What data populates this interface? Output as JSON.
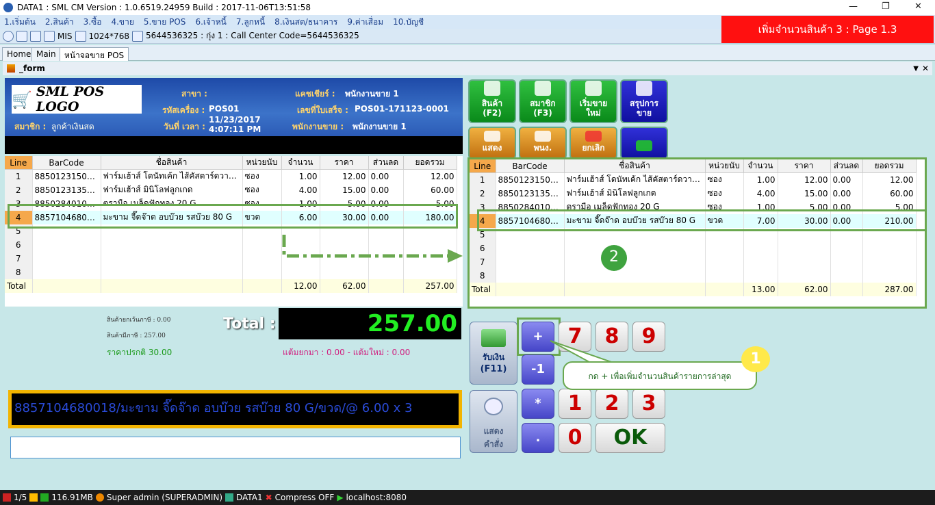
{
  "window": {
    "title": "DATA1 : SML CM Version : 1.0.6519.24959  Build : 2017-11-06T13:51:58"
  },
  "menu": [
    "1.เริ่มต้น",
    "2.สินค้า",
    "3.ซื้อ",
    "4.ขาย",
    "5.ขาย POS",
    "6.เจ้าหนี้",
    "7.ลูกหนี้",
    "8.เงินสด/ธนาคาร",
    "9.ค่าเสื่อม",
    "10.บัญชี"
  ],
  "toolbar": {
    "mis": "MIS",
    "resolution": "1024*768",
    "info": "5644536325 : กุ่ง 1 : Call Center Code=5644536325"
  },
  "banner": "เพิ่มจำนวนสินค้า 3 : Page 1.3",
  "tabs": [
    "Home",
    "Main",
    "หน้าจอขาย POS"
  ],
  "form_title": "_form",
  "header": {
    "logo": "SML POS LOGO",
    "branch_label": "สาขา :",
    "machine_label": "รหัสเครื่อง :",
    "machine_value": "POS01",
    "datetime_label": "วันที่ เวลา :",
    "date_value": "11/23/2017",
    "time_value": "4:07:11 PM",
    "member_label": "สมาชิก :",
    "member_value": "ลูกค้าเงินสด",
    "cashier_label": "แคชเชียร์ :",
    "cashier_value": "พนักงานขาย 1",
    "receipt_label": "เลขที่ใบเสร็จ :",
    "receipt_value": "POS01-171123-0001",
    "sales_label": "พนักงานขาย :",
    "sales_value": "พนักงานขาย 1"
  },
  "columns": [
    "Line",
    "BarCode",
    "ชื่อสินค้า",
    "หน่วยนับ",
    "จำนวน",
    "ราคา",
    "ส่วนลด",
    "ยอดรวม"
  ],
  "left_rows": [
    {
      "line": "1",
      "barcode": "8850123150500",
      "name": "ฟาร์มเฮ้าส์  โดนัทเค้ก ไส้คัสตาร์ดวานิล..",
      "unit": "ซอง",
      "qty": "1.00",
      "price": "12.00",
      "disc": "0.00",
      "total": "12.00"
    },
    {
      "line": "2",
      "barcode": "8850123135033",
      "name": "ฟาร์มเฮ้าส์  มินิโลฟลูกเกด",
      "unit": "ซอง",
      "qty": "4.00",
      "price": "15.00",
      "disc": "0.00",
      "total": "60.00"
    },
    {
      "line": "3",
      "barcode": "8850284010316",
      "name": "ตรามือ  เมล็ดฟักทอง  20 G",
      "unit": "ซอง",
      "qty": "1.00",
      "price": "5.00",
      "disc": "0.00",
      "total": "5.00"
    },
    {
      "line": "4",
      "barcode": "8857104680018",
      "name": "มะขาม  จี๊ดจ๊าด  อบบ๊วย  รสบ๊วย  80 G",
      "unit": "ขวด",
      "qty": "6.00",
      "price": "30.00",
      "disc": "0.00",
      "total": "180.00"
    },
    {
      "line": "5"
    },
    {
      "line": "6"
    },
    {
      "line": "7"
    },
    {
      "line": "8"
    }
  ],
  "left_total": {
    "label": "Total",
    "qty": "12.00",
    "price": "62.00",
    "total": "257.00"
  },
  "right_rows": [
    {
      "line": "1",
      "barcode": "8850123150500",
      "name": "ฟาร์มเฮ้าส์  โดนัทเค้ก ไส้คัสตาร์ดวานิล..",
      "unit": "ซอง",
      "qty": "1.00",
      "price": "12.00",
      "disc": "0.00",
      "total": "12.00"
    },
    {
      "line": "2",
      "barcode": "8850123135033",
      "name": "ฟาร์มเฮ้าส์  มินิโลฟลูกเกด",
      "unit": "ซอง",
      "qty": "4.00",
      "price": "15.00",
      "disc": "0.00",
      "total": "60.00"
    },
    {
      "line": "3",
      "barcode": "8850284010316",
      "name": "ตรามือ  เมล็ดฟักทอง  20 G",
      "unit": "ซอง",
      "qty": "1.00",
      "price": "5.00",
      "disc": "0.00",
      "total": "5.00"
    },
    {
      "line": "4",
      "barcode": "8857104680018",
      "name": "มะขาม  จี๊ดจ๊าด  อบบ๊วย  รสบ๊วย  80 G",
      "unit": "ขวด",
      "qty": "7.00",
      "price": "30.00",
      "disc": "0.00",
      "total": "210.00"
    },
    {
      "line": "5"
    },
    {
      "line": "6"
    },
    {
      "line": "7"
    },
    {
      "line": "8"
    }
  ],
  "right_total": {
    "label": "Total",
    "qty": "13.00",
    "price": "62.00",
    "total": "287.00"
  },
  "summary": {
    "exempt_label": "สินค้ายกเว้นภาษี : 0.00",
    "vat_label": "สินค้ามีภาษี : 257.00",
    "normal_price": "ราคาปรกติ 30.00",
    "total_label": "Total :",
    "total_value": "257.00",
    "points": "แต้มยกมา : 0.00 - แต้มใหม่ : 0.00"
  },
  "scroll_text": "8857104680018/มะขาม  จี๊ดจ๊าด  อบบ๊วย  รสบ๊วย  80 G/ขวด/@ 6.00 x 3",
  "buttons": {
    "product": "สินค้า",
    "product_key": "(F2)",
    "member": "สมาชิก",
    "member_key": "(F3)",
    "new_sale": "เริ่มขาย",
    "new_sale2": "ใหม่",
    "summary": "สรุปการ",
    "summary2": "ขาย",
    "show": "แสดง",
    "staff": "พนง.",
    "cancel": "ยกเลิก",
    "receive": "รับเงิน",
    "receive_key": "(F11)",
    "show_order": "แสดง",
    "show_order2": "คำสั่ง",
    "plus": "+",
    "minus": "-1",
    "star": "*",
    "dot": ".",
    "ok": "OK",
    "digits": [
      "7",
      "8",
      "9",
      "1",
      "2",
      "3",
      "0"
    ]
  },
  "callout": {
    "n1": "1",
    "n2": "2",
    "text": "กด + เพื่อเพิ่มจำนวนสินค้ารายการล่าสุด"
  },
  "status": {
    "page": "1/5",
    "memory": "116.91MB",
    "user": "Super admin (SUPERADMIN)",
    "db": "DATA1",
    "compress": "Compress OFF",
    "host": "localhost:8080"
  },
  "colors": {
    "accent_green": "#6aa84f",
    "banner_red": "#ff1010",
    "total_green": "#22ee22"
  }
}
